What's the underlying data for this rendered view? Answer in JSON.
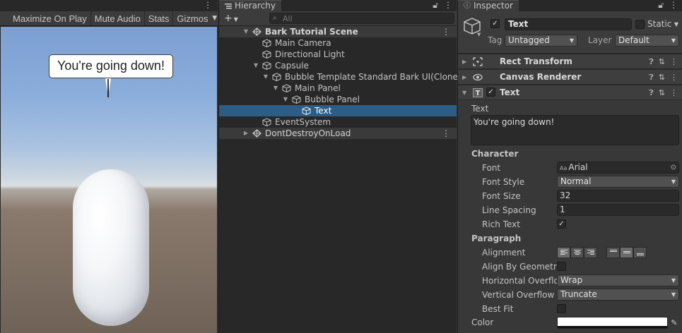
{
  "game_view": {
    "toolbar": {
      "maximize_label": "Maximize On Play",
      "mute_label": "Mute Audio",
      "stats_label": "Stats",
      "gizmos_label": "Gizmos"
    },
    "bubble_text": "You're going down!",
    "colors": {
      "sky_top": "#7c9fd2",
      "ground": "#6f6256",
      "capsule": "#f4f6f8"
    }
  },
  "hierarchy": {
    "tab_label": "Hierarchy",
    "search_placeholder": "All",
    "items": [
      {
        "label": "Bark Tutorial Scene",
        "icon": "unity-scene-icon",
        "expanded": true,
        "kind": "scene"
      },
      {
        "label": "Main Camera",
        "icon": "gameobject-cube-icon"
      },
      {
        "label": "Directional Light",
        "icon": "gameobject-cube-icon"
      },
      {
        "label": "Capsule",
        "icon": "gameobject-cube-icon",
        "expanded": true
      },
      {
        "label": "Bubble Template Standard Bark UI(Clone)",
        "icon": "gameobject-cube-icon",
        "expanded": true
      },
      {
        "label": "Main Panel",
        "icon": "gameobject-cube-icon",
        "expanded": true
      },
      {
        "label": "Bubble Panel",
        "icon": "gameobject-cube-icon",
        "expanded": true
      },
      {
        "label": "Text",
        "icon": "gameobject-cube-icon",
        "selected": true
      },
      {
        "label": "EventSystem",
        "icon": "gameobject-cube-icon"
      },
      {
        "label": "DontDestroyOnLoad",
        "icon": "unity-scene-icon",
        "expanded": false,
        "kind": "scene"
      }
    ]
  },
  "inspector": {
    "tab_label": "Inspector",
    "object_name": "Text",
    "static_label": "Static",
    "tag_label": "Tag",
    "tag_value": "Untagged",
    "layer_label": "Layer",
    "layer_value": "Default",
    "components": {
      "rect_transform": "Rect Transform",
      "canvas_renderer": "Canvas Renderer",
      "text": "Text"
    },
    "text_label": "Text",
    "text_value": "You're going down!",
    "character_header": "Character",
    "font_label": "Font",
    "font_value": "Arial",
    "font_style_label": "Font Style",
    "font_style_value": "Normal",
    "font_size_label": "Font Size",
    "font_size_value": "32",
    "line_spacing_label": "Line Spacing",
    "line_spacing_value": "1",
    "rich_text_label": "Rich Text",
    "rich_text_checked": true,
    "paragraph_header": "Paragraph",
    "alignment_label": "Alignment",
    "align_by_geometry_label": "Align By Geometry",
    "horizontal_overflow_label": "Horizontal Overflow",
    "horizontal_overflow_value": "Wrap",
    "vertical_overflow_label": "Vertical Overflow",
    "vertical_overflow_value": "Truncate",
    "best_fit_label": "Best Fit",
    "color_label": "Color",
    "color_value": "#ffffff"
  }
}
